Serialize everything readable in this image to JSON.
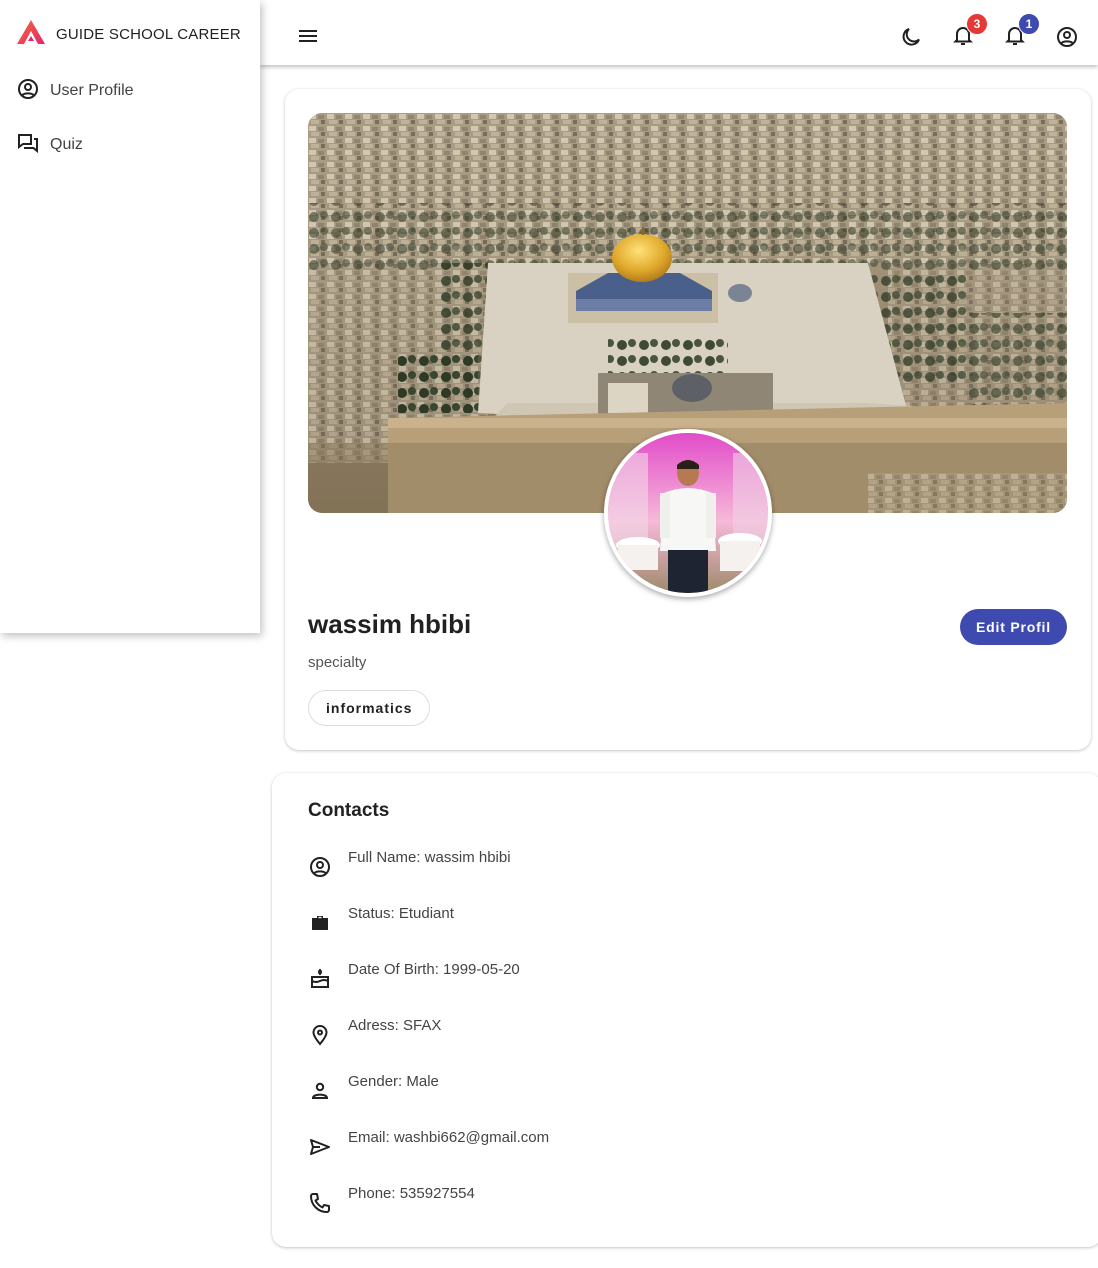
{
  "app": {
    "brand_name": "GUIDE SCHOOL CAREER",
    "brand_colors": [
      "#e5256c",
      "#f26b3a"
    ]
  },
  "sidebar": {
    "items": [
      {
        "label": "User Profile",
        "icon": "account-circle-icon"
      },
      {
        "label": "Quiz",
        "icon": "forum-icon"
      }
    ]
  },
  "topbar": {
    "icons": [
      "menu-icon",
      "moon-icon",
      "bell-icon",
      "bell-icon",
      "account-circle-icon"
    ],
    "notifications_a": {
      "count": "3",
      "color": "#e53935"
    },
    "notifications_b": {
      "count": "1",
      "color": "#3f4ab0"
    }
  },
  "profile": {
    "name": "wassim hbibi",
    "specialty_label": "specialty",
    "specialty": "informatics",
    "edit_label": "Edit Profil",
    "accent": "#3f4ab0"
  },
  "contacts": {
    "title": "Contacts",
    "items": [
      {
        "icon": "account-circle-icon",
        "text": "Full Name: wassim hbibi"
      },
      {
        "icon": "briefcase-icon",
        "text": "Status: Etudiant"
      },
      {
        "icon": "cake-icon",
        "text": "Date Of Birth: 1999-05-20"
      },
      {
        "icon": "location-pin-icon",
        "text": "Adress: SFAX"
      },
      {
        "icon": "person-icon",
        "text": "Gender: Male"
      },
      {
        "icon": "send-icon",
        "text": "Email: washbi662@gmail.com"
      },
      {
        "icon": "phone-icon",
        "text": "Phone: 535927554"
      }
    ]
  }
}
